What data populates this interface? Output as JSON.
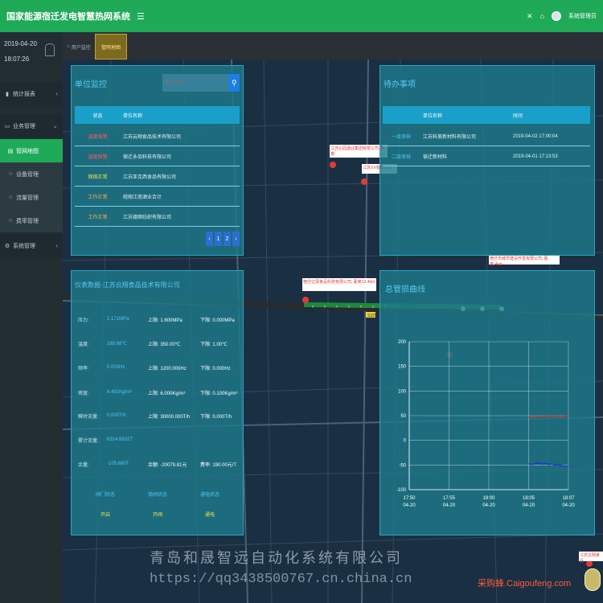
{
  "header": {
    "title": "国家能源宿迁发电智慧热网系统",
    "menu_icon": "bars-icon",
    "user": "系统管理员",
    "icons": [
      "close-icon",
      "home-icon",
      "avatar"
    ]
  },
  "sidebar": {
    "date": "2019-04-20",
    "time": "18:07:26",
    "items": [
      {
        "label": "统计报表",
        "icon": "bar-chart-icon"
      },
      {
        "label": "业务管理",
        "icon": "monitor-icon"
      },
      {
        "label": "管网地图",
        "icon": "map-icon"
      },
      {
        "label": "设备管理",
        "icon": "circle-icon"
      },
      {
        "label": "流量管理",
        "icon": "circle-icon"
      },
      {
        "label": "费率管理",
        "icon": "circle-icon"
      },
      {
        "label": "系统管理",
        "icon": "gear-icon"
      }
    ]
  },
  "tabs": [
    {
      "label": "用户监控"
    },
    {
      "label": "管网地图"
    }
  ],
  "unit_monitor": {
    "title": "单位监控",
    "search_placeholder": "单位名称...",
    "columns": [
      "状态",
      "单位名称"
    ],
    "rows": [
      {
        "status": "温度报警",
        "name": "江苏云翔食品技术有限公司",
        "level": "red"
      },
      {
        "status": "温度报警",
        "name": "宿迁永佰科技有限公司",
        "level": "red"
      },
      {
        "status": "网络正常",
        "name": "江苏亚克西食品有限公司",
        "level": "yellow"
      },
      {
        "status": "工作正常",
        "name": "皖翔江南酒业合计",
        "level": "work"
      },
      {
        "status": "工作正常",
        "name": "江苏德顺纺织有限公司",
        "level": "work"
      }
    ],
    "pager": [
      "‹",
      "1",
      "2",
      "›"
    ]
  },
  "todo": {
    "title": "待办事项",
    "columns": [
      "",
      "单位名称",
      "时间"
    ],
    "rows": [
      {
        "type": "一级审核",
        "name": "江苏科美新材料有限公司",
        "time": "2019-04-02 17:00:04"
      },
      {
        "type": "二级审核",
        "name": "宿迁新材料",
        "time": "2019-04-01 17:13:53"
      }
    ]
  },
  "meter": {
    "title": "仪表数据-江苏云翔食品技术有限公司",
    "rows": [
      {
        "label": "压力:",
        "value": "1.171MPa",
        "upper": "上限: 1.600MPa",
        "lower": "下限: 0.000MPa"
      },
      {
        "label": "温度:",
        "value": "189.68℃",
        "upper": "上限: 350.00℃",
        "lower": "下限: 1.00℃"
      },
      {
        "label": "频率:",
        "value": "0.000Hz",
        "upper": "上限: 1200.000Hz",
        "lower": "下限: 0.000Hz"
      },
      {
        "label": "密度:",
        "value": "6.491Kg/m³",
        "upper": "上限: 6.000Kg/m³",
        "lower": "下限: 0.100Kg/m³"
      },
      {
        "label": "瞬时流量:",
        "value": "0.000T/h",
        "upper": "上限: 30000.000T/h",
        "lower": "下限: 0.000T/h"
      },
      {
        "label": "累计流量:",
        "value": "6314.6832T",
        "upper": "",
        "lower": ""
      },
      {
        "label": "余量:",
        "value": "-105.680T",
        "upper": "余额: -20079.81元",
        "lower": "费率: 190.00元/T"
      }
    ],
    "switches": [
      {
        "label": "阀门状态",
        "value": "开启"
      },
      {
        "label": "锁阀状态",
        "value": "开阀"
      },
      {
        "label": "通电状态",
        "value": "通电"
      }
    ]
  },
  "map": {
    "labels": [
      "江苏沁园酒业集团有限公司, 距离:",
      "江苏XX有限公司",
      "宿迁亿源食品科技有限公司, 距离12.4km",
      "宿迁市城市建设开发有限公司, 距离:4km",
      "江苏云翔食品"
    ],
    "road_label": "S325"
  },
  "chart_data": {
    "type": "line",
    "title": "总管损曲线",
    "x": [
      "17:50\n04-20",
      "17:55\n04-20",
      "18:00\n04-20",
      "18:05\n04-20",
      "18:07\n04-20"
    ],
    "ylim": [
      -100,
      200
    ],
    "yticks": [
      200,
      150,
      100,
      50,
      0,
      -50,
      -100
    ],
    "grid": true,
    "series": [
      {
        "color": "#c0392b",
        "points": [
          [
            18.0,
            47
          ],
          [
            18.5,
            48
          ],
          [
            19.0,
            47
          ],
          [
            19.5,
            49
          ],
          [
            20.0,
            48
          ],
          [
            20.5,
            49
          ],
          [
            21.0,
            48
          ],
          [
            21.5,
            49
          ],
          [
            22.0,
            48
          ],
          [
            22.5,
            49
          ],
          [
            23.0,
            48
          ],
          [
            23.5,
            49
          ],
          [
            24.0,
            49
          ]
        ]
      },
      {
        "color": "#1d36c8",
        "points": [
          [
            18.0,
            -48
          ],
          [
            18.5,
            -49
          ],
          [
            19.0,
            -47
          ],
          [
            19.5,
            -46
          ],
          [
            20.0,
            -48
          ],
          [
            20.5,
            -47
          ],
          [
            21.0,
            -49
          ],
          [
            21.5,
            -48
          ],
          [
            22.0,
            -50
          ],
          [
            22.5,
            -49
          ],
          [
            23.0,
            -51
          ],
          [
            23.5,
            -52
          ],
          [
            24.0,
            -52
          ]
        ]
      }
    ],
    "x_range": [
      0,
      24
    ]
  },
  "watermark": {
    "company": "青岛和晟智远自动化系统有限公司",
    "url": "https://qq3438500767.cn.china.cn",
    "site": "采购蜂.Caigoufeng.com"
  }
}
